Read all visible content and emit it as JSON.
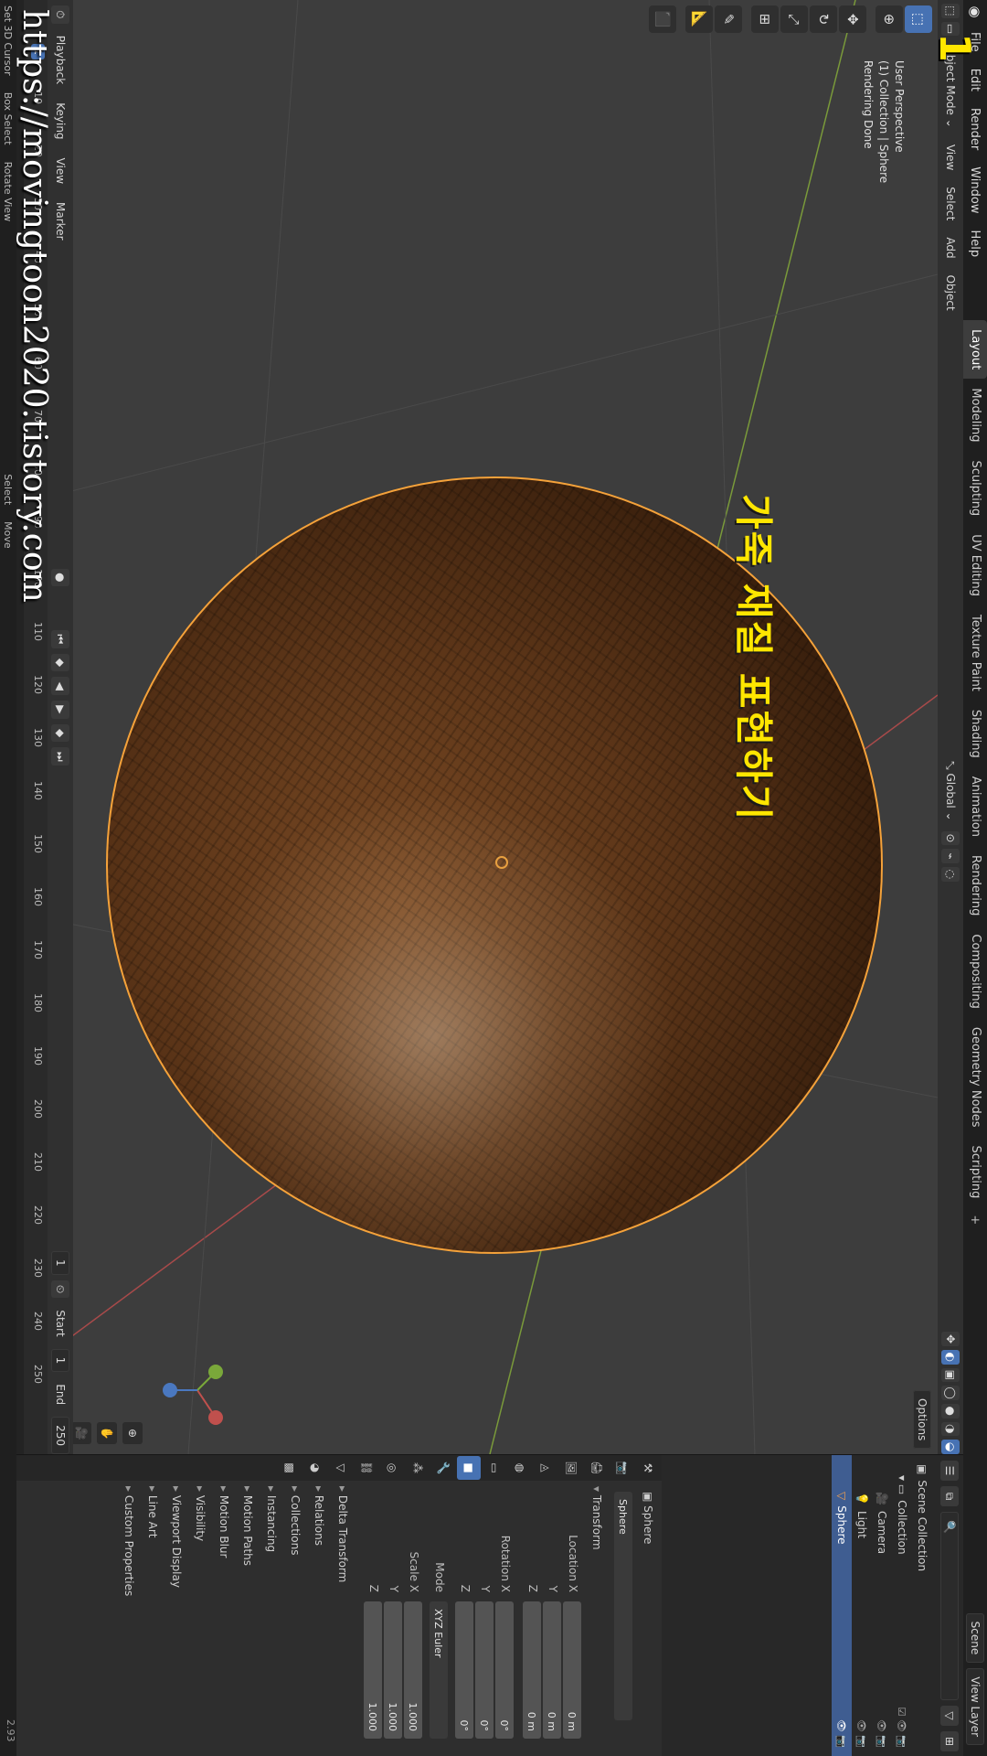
{
  "menubar": {
    "logo_icon": "blender-logo-icon",
    "menus": [
      "File",
      "Edit",
      "Render",
      "Window",
      "Help"
    ],
    "workspaces": [
      "Layout",
      "Modeling",
      "Sculpting",
      "UV Editing",
      "Texture Paint",
      "Shading",
      "Animation",
      "Rendering",
      "Compositing",
      "Geometry Nodes",
      "Scripting"
    ],
    "active_workspace": "Layout",
    "add_tab": "+",
    "scene_label": "Scene",
    "view_layer_label": "View Layer"
  },
  "viewport_header": {
    "mode": "Object Mode",
    "menus": [
      "View",
      "Select",
      "Add",
      "Object"
    ],
    "orientation": "Global",
    "options_label": "Options"
  },
  "viewport_info": {
    "line1": "User Perspective",
    "line2": "(1) Collection | Sphere",
    "line3": "Rendering Done"
  },
  "overlay_title": "가죽 재질 표현하기",
  "overlay_number": "1",
  "overlay_url": "https://movingtoon2020.tistory.com",
  "timeline": {
    "menus": [
      "Playback",
      "Keying",
      "View",
      "Marker"
    ],
    "current_frame": "1",
    "ticks": [
      "10",
      "20",
      "30",
      "40",
      "50",
      "60",
      "70",
      "80",
      "90",
      "100",
      "110",
      "120",
      "130",
      "140",
      "150",
      "160",
      "170",
      "180",
      "190",
      "200",
      "210",
      "220",
      "230",
      "240",
      "250"
    ],
    "frame_field": "1",
    "start_label": "Start",
    "start_value": "1",
    "end_label": "End",
    "end_value": "250"
  },
  "status_bar": {
    "items": [
      "Set 3D Cursor",
      "Box Select",
      "Rotate View",
      "Select",
      "Move"
    ],
    "version": "2.93"
  },
  "outliner": {
    "rows": [
      {
        "label": "Scene Collection",
        "indent": 0
      },
      {
        "label": "Collection",
        "indent": 1
      },
      {
        "label": "Camera",
        "indent": 2
      },
      {
        "label": "Light",
        "indent": 2
      },
      {
        "label": "Sphere",
        "indent": 2,
        "selected": true
      }
    ]
  },
  "properties": {
    "object_name": "Sphere",
    "object_field": "Sphere",
    "transform_label": "Transform",
    "location_labels": [
      "Location X",
      "Y",
      "Z"
    ],
    "location_values": [
      "0 m",
      "0 m",
      "0 m"
    ],
    "rotation_labels": [
      "Rotation X",
      "Y",
      "Z"
    ],
    "rotation_values": [
      "0°",
      "0°",
      "0°"
    ],
    "mode_label": "Mode",
    "mode_value": "XYZ Euler",
    "scale_labels": [
      "Scale X",
      "Y",
      "Z"
    ],
    "scale_values": [
      "1.000",
      "1.000",
      "1.000"
    ],
    "sections": [
      "Delta Transform",
      "Relations",
      "Collections",
      "Instancing",
      "Motion Paths",
      "Motion Blur",
      "Visibility",
      "Viewport Display",
      "Line Art",
      "Custom Properties"
    ]
  },
  "colors": {
    "accent": "#4772b3",
    "selection_outline": "#f5a23a",
    "title_yellow": "#ffe600"
  }
}
